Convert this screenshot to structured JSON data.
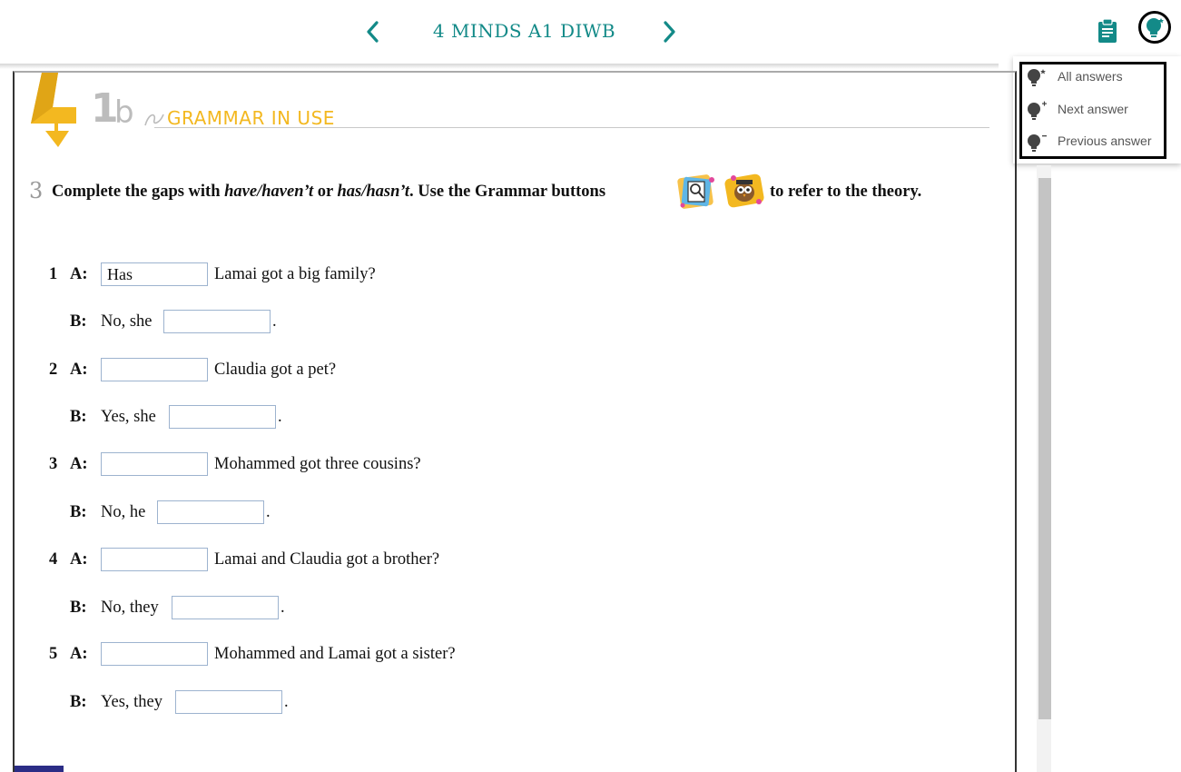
{
  "header": {
    "book_title": "4 MINDS A1 DIWB"
  },
  "answers_menu": {
    "items": [
      {
        "label": "All answers",
        "icon": "bulb-all-icon"
      },
      {
        "label": "Next answer",
        "icon": "bulb-plus-icon"
      },
      {
        "label": "Previous answer",
        "icon": "bulb-minus-icon"
      }
    ]
  },
  "unit": {
    "number": "1",
    "letter": "b",
    "section_title": "GRAMMAR IN USE"
  },
  "exercise": {
    "number": "3",
    "instruction_parts": [
      "Complete the gaps with ",
      "have/haven’t",
      " or ",
      "has/hasn’t",
      ". Use the Grammar buttons"
    ],
    "instruction_end": "to refer to the theory.",
    "items": [
      {
        "num": "1",
        "a_pre": "",
        "a_value": "Has",
        "a_post": "Lamai got a big family?",
        "b_pre": "No, she",
        "b_value": "",
        "b_post": "."
      },
      {
        "num": "2",
        "a_pre": "",
        "a_value": "",
        "a_post": "Claudia got a pet?",
        "b_pre": "Yes, she",
        "b_value": "",
        "b_post": "."
      },
      {
        "num": "3",
        "a_pre": "",
        "a_value": "",
        "a_post": "Mohammed got three cousins?",
        "b_pre": "No, he",
        "b_value": "",
        "b_post": "."
      },
      {
        "num": "4",
        "a_pre": "",
        "a_value": "",
        "a_post": "Lamai and Claudia got a brother?",
        "b_pre": "No, they",
        "b_value": "",
        "b_post": "."
      },
      {
        "num": "5",
        "a_pre": "",
        "a_value": "",
        "a_post": "Mohammed and Lamai got a sister?",
        "b_pre": "Yes, they",
        "b_value": "",
        "b_post": "."
      }
    ],
    "speaker_a": "A:",
    "speaker_b": "B:"
  },
  "colors": {
    "accent_teal": "#138a88",
    "section_yellow": "#f3b820",
    "gap_border": "#9db3cf"
  }
}
